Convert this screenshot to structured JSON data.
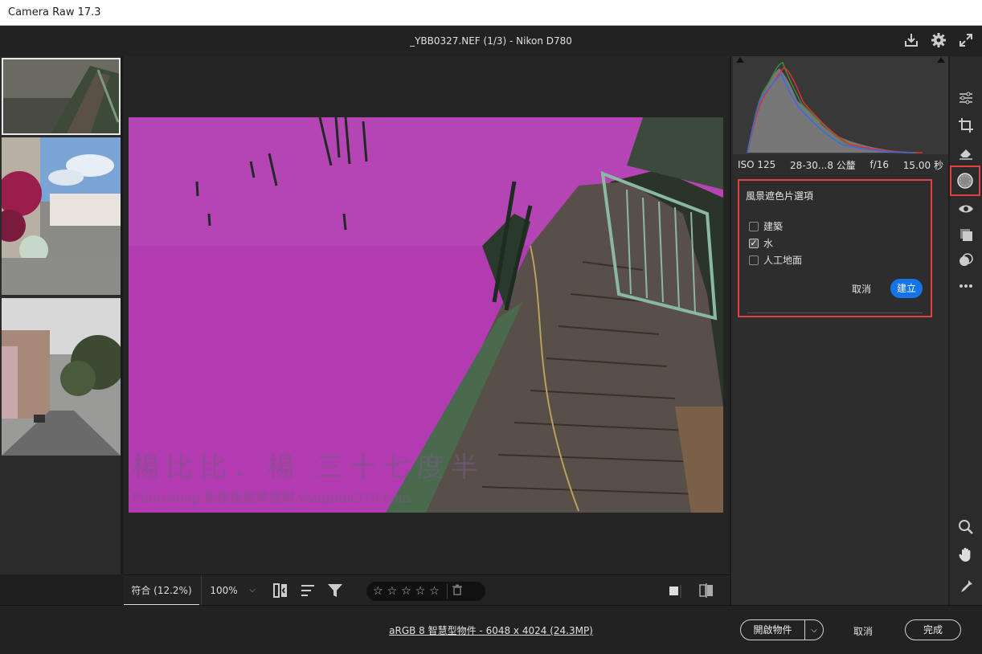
{
  "window": {
    "title": "Camera Raw 17.3"
  },
  "header": {
    "file_title": "_YBB0327.NEF (1/3)  -  Nikon D780"
  },
  "canvas": {
    "watermark_line1": "楊比比．楊  三十七度半",
    "watermark_line2": "Photoshop 影像後製學習網 yangbibi375.com"
  },
  "bottombar": {
    "zoom_fit": "符合 (12.2%)",
    "zoom_100": "100%",
    "zoom_dropdown": "⌵",
    "stars": [
      "☆",
      "☆",
      "☆",
      "☆",
      "☆"
    ]
  },
  "exif": {
    "iso": "ISO 125",
    "focal": "28-30...8 公釐",
    "aperture": "f/16",
    "shutter": "15.00 秒"
  },
  "dialog": {
    "title": "風景遮色片選項",
    "options": [
      {
        "label": "建築",
        "checked": false,
        "mark": ""
      },
      {
        "label": "水",
        "checked": true,
        "mark": "✓"
      },
      {
        "label": "人工地面",
        "checked": false,
        "mark": ""
      }
    ],
    "cancel": "取消",
    "create": "建立"
  },
  "footer": {
    "info_link": "aRGB 8 智慧型物件 - 6048 x 4024 (24.3MP)",
    "open_label": "開啟物件",
    "open_dropdown": "⌵",
    "cancel": "取消",
    "done": "完成"
  },
  "colors": {
    "accent": "#1473e6",
    "highlight": "#e34141",
    "mask": "#b23bb2"
  }
}
